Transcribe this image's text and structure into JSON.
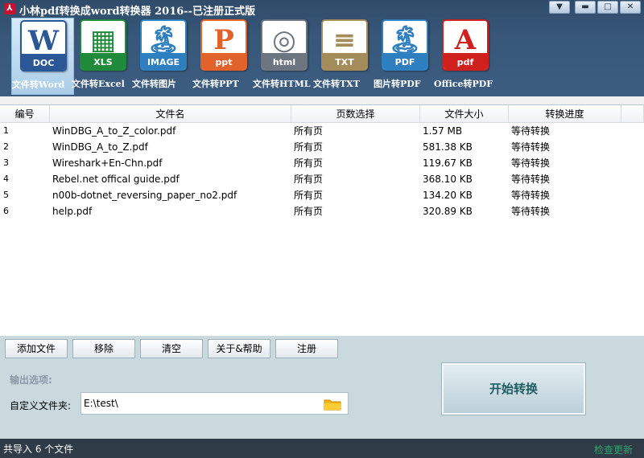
{
  "window": {
    "title": "小林pdf转换成word转换器 2016--已注册正式版",
    "app_icon": "acrobat-icon",
    "controls": [
      "dropdown",
      "minimize",
      "maximize",
      "close"
    ]
  },
  "toolbar": {
    "items": [
      {
        "label": "文件转Word",
        "icon": "doc-icon",
        "tag": "DOC",
        "big": "W",
        "color": "#2b5797",
        "active": true
      },
      {
        "label": "文件转Excel",
        "icon": "xls-icon",
        "tag": "XLS",
        "big": "▦",
        "color": "#1f8a3a",
        "active": false
      },
      {
        "label": "文件转图片",
        "icon": "image-icon",
        "tag": "IMAGE",
        "big": "🏝",
        "color": "#2e7fbf",
        "active": false
      },
      {
        "label": "文件转PPT",
        "icon": "ppt-icon",
        "tag": "ppt",
        "big": "P",
        "color": "#e2622c",
        "active": false
      },
      {
        "label": "文件转HTML",
        "icon": "html-icon",
        "tag": "html",
        "big": "◎",
        "color": "#6d7580",
        "active": false
      },
      {
        "label": "文件转TXT",
        "icon": "txt-icon",
        "tag": "TXT",
        "big": "≡",
        "color": "#a38c5a",
        "active": false
      },
      {
        "label": "图片转PDF",
        "icon": "image-to-pdf-icon",
        "tag": "PDF",
        "big": "🏝",
        "color": "#2e7fbf",
        "active": false
      },
      {
        "label": "Office转PDF",
        "icon": "pdf-icon",
        "tag": "pdf",
        "big": "A",
        "color": "#d0201e",
        "active": false
      }
    ]
  },
  "table": {
    "columns": [
      "编号",
      "文件名",
      "页数选择",
      "文件大小",
      "转换进度"
    ],
    "rows": [
      {
        "num": "1",
        "name": "WinDBG_A_to_Z_color.pdf",
        "pages": "所有页",
        "size": "1.57 MB",
        "progress": "等待转换"
      },
      {
        "num": "2",
        "name": "WinDBG_A_to_Z.pdf",
        "pages": "所有页",
        "size": "581.38 KB",
        "progress": "等待转换"
      },
      {
        "num": "3",
        "name": "Wireshark+En-Chn.pdf",
        "pages": "所有页",
        "size": "119.67 KB",
        "progress": "等待转换"
      },
      {
        "num": "4",
        "name": "Rebel.net offical guide.pdf",
        "pages": "所有页",
        "size": "368.10 KB",
        "progress": "等待转换"
      },
      {
        "num": "5",
        "name": "n00b-dotnet_reversing_paper_no2.pdf",
        "pages": "所有页",
        "size": "134.20 KB",
        "progress": "等待转换"
      },
      {
        "num": "6",
        "name": "help.pdf",
        "pages": "所有页",
        "size": "320.89 KB",
        "progress": "等待转换"
      }
    ]
  },
  "actions": {
    "add": "添加文件",
    "remove": "移除",
    "clear": "清空",
    "about": "关于&帮助",
    "register": "注册"
  },
  "output": {
    "title": "输出选项:",
    "folder_label": "自定义文件夹:",
    "folder_value": "E:\\test\\",
    "folder_icon": "folder-icon"
  },
  "start_button": "开始转换",
  "status": {
    "left": "共导入 6 个文件",
    "right": "检查更新"
  },
  "colors": {
    "toolbar_bg": "#3a5a7c",
    "panel_bg": "#c9d9de",
    "start_text": "#1e5e62",
    "update_link": "#2fa56b"
  }
}
